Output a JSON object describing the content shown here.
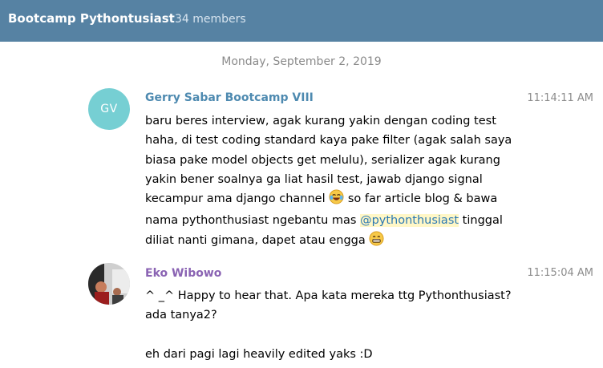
{
  "header": {
    "title": "Bootcamp Pythontusiast",
    "members": "34 members"
  },
  "date_separator": "Monday, September 2, 2019",
  "messages": [
    {
      "avatar_initials": "GV",
      "sender": "Gerry Sabar Bootcamp VIII",
      "sender_color": "#4e8ab0",
      "time": "11:14:11 AM",
      "text": {
        "p1": "baru beres interview, agak kurang yakin dengan coding test haha, di test coding standard kaya pake filter (agak salah saya biasa pake model objects get melulu), serializer agak kurang yakin bener soalnya ga liat hasil test, jawab django signal kecampur ama django channel",
        "p1_emoji": "laughing-tears-emoji",
        "p2": " so far article blog & bawa nama pythonthusiast ngebantu mas ",
        "mention": "@pythonthusiast",
        "p3": " tinggal diliat nanti gimana, dapet atau engga",
        "p3_emoji": "grinning-emoji"
      }
    },
    {
      "avatar": "user-photo",
      "sender": "Eko Wibowo",
      "sender_color": "#8a63b3",
      "time": "11:15:04 AM",
      "text": {
        "line1": "^ _^ Happy to hear that. Apa kata mereka ttg Pythonthusiast? ada tanya2?",
        "line2": "eh dari pagi lagi heavily edited yaks :D"
      }
    }
  ]
}
